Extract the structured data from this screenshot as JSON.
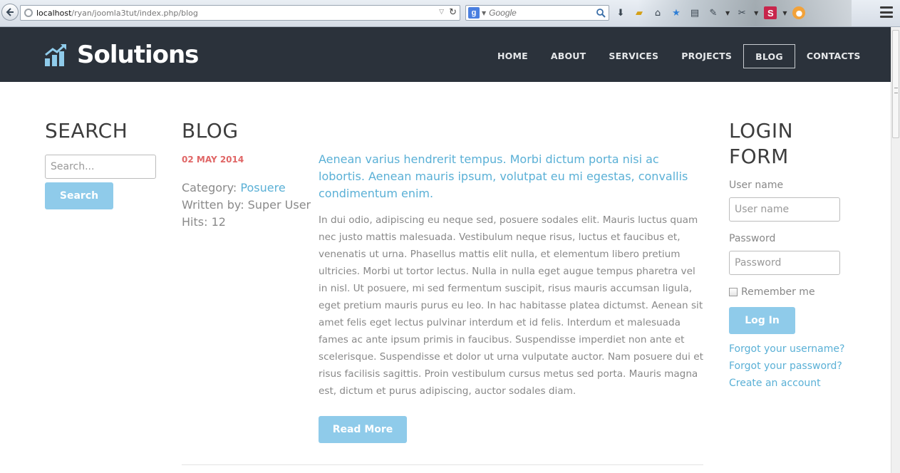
{
  "browser": {
    "url_host": "localhost",
    "url_path": "/ryan/joomla3tut/index.php/blog",
    "search_engine_placeholder": "Google"
  },
  "site": {
    "logo_text": "Solutions",
    "nav": [
      {
        "label": "HOME",
        "active": false
      },
      {
        "label": "ABOUT",
        "active": false
      },
      {
        "label": "SERVICES",
        "active": false
      },
      {
        "label": "PROJECTS",
        "active": false
      },
      {
        "label": "BLOG",
        "active": true
      },
      {
        "label": "CONTACTS",
        "active": false
      }
    ]
  },
  "search": {
    "heading": "SEARCH",
    "placeholder": "Search...",
    "button_label": "Search"
  },
  "blog": {
    "heading": "BLOG",
    "post": {
      "date": "02 MAY 2014",
      "category_label": "Category: ",
      "category": "Posuere",
      "author": "Written by: Super User",
      "hits": "Hits: 12",
      "title": "Aenean varius hendrerit tempus. Morbi dictum porta nisi ac lobortis. Aenean mauris ipsum, volutpat eu mi egestas, convallis condimentum enim.",
      "body": "In dui odio, adipiscing eu neque sed, posuere sodales elit. Mauris luctus quam nec justo mattis malesuada. Vestibulum neque risus, luctus et faucibus et, venenatis ut urna. Phasellus mattis elit nulla, et elementum libero pretium ultricies. Morbi ut tortor lectus. Nulla in nulla eget augue tempus pharetra vel in nisl. Ut posuere, mi sed fermentum suscipit, risus mauris accumsan ligula, eget pretium mauris purus eu leo. In hac habitasse platea dictumst. Aenean sit amet felis eget lectus pulvinar interdum et id felis. Interdum et malesuada fames ac ante ipsum primis in faucibus. Suspendisse imperdiet non ante et scelerisque. Suspendisse et dolor ut urna vulputate auctor. Nam posuere dui et risus facilisis sagittis. Proin vestibulum cursus metus sed porta. Mauris magna est, dictum et purus adipiscing, auctor sodales diam.",
      "read_more": "Read More"
    }
  },
  "login": {
    "heading_line1": "LOGIN",
    "heading_line2": "FORM",
    "username_label": "User name",
    "username_placeholder": "User name",
    "password_label": "Password",
    "password_placeholder": "Password",
    "remember_label": "Remember me",
    "button_label": "Log In",
    "links": [
      "Forgot your username?",
      "Forgot your password?",
      "Create an account"
    ]
  },
  "colors": {
    "header_bg": "#2b323b",
    "accent_link": "#5ab0d6",
    "button_bg": "#8fcbea",
    "date_red": "#e06666"
  }
}
